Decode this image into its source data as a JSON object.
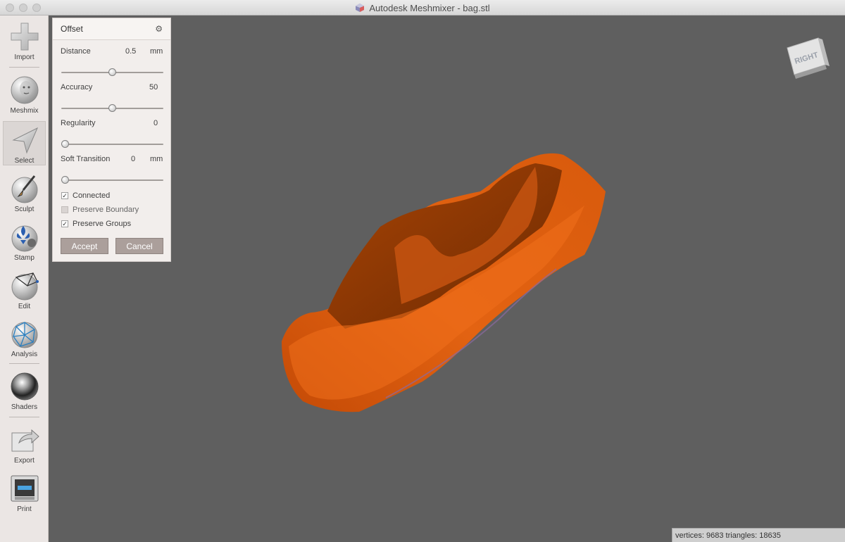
{
  "window": {
    "title": "Autodesk Meshmixer - bag.stl"
  },
  "toolbar": {
    "items": [
      {
        "label": "Import",
        "icon": "plus-icon"
      },
      {
        "label": "Meshmix",
        "icon": "face-sphere-icon"
      },
      {
        "label": "Select",
        "icon": "arrow-cursor-icon",
        "active": true
      },
      {
        "label": "Sculpt",
        "icon": "brush-sphere-icon"
      },
      {
        "label": "Stamp",
        "icon": "fleur-stamp-icon"
      },
      {
        "label": "Edit",
        "icon": "wire-sphere-icon"
      },
      {
        "label": "Analysis",
        "icon": "mesh-sphere-icon"
      },
      {
        "label": "Shaders",
        "icon": "chrome-sphere-icon"
      },
      {
        "label": "Export",
        "icon": "export-arrow-icon"
      },
      {
        "label": "Print",
        "icon": "printer-icon"
      }
    ]
  },
  "panel": {
    "title": "Offset",
    "distance": {
      "label": "Distance",
      "value": "0.5",
      "unit": "mm",
      "slider": 0.5
    },
    "accuracy": {
      "label": "Accuracy",
      "value": "50",
      "slider": 0.5
    },
    "regularity": {
      "label": "Regularity",
      "value": "0",
      "slider": 0.0
    },
    "soft_transition": {
      "label": "Soft Transition",
      "value": "0",
      "unit": "mm",
      "slider": 0.0
    },
    "checkboxes": [
      {
        "label": "Connected",
        "checked": true
      },
      {
        "label": "Preserve Boundary",
        "checked": false
      },
      {
        "label": "Preserve Groups",
        "checked": true
      }
    ],
    "accept_label": "Accept",
    "cancel_label": "Cancel"
  },
  "viewcube": {
    "face_label": "RIGHT"
  },
  "status": {
    "text": "vertices: 9683 triangles: 18635"
  },
  "colors": {
    "viewport_bg": "#5f5f5f",
    "mesh": "#e05a10",
    "panel_button": "#ab9f9b"
  }
}
